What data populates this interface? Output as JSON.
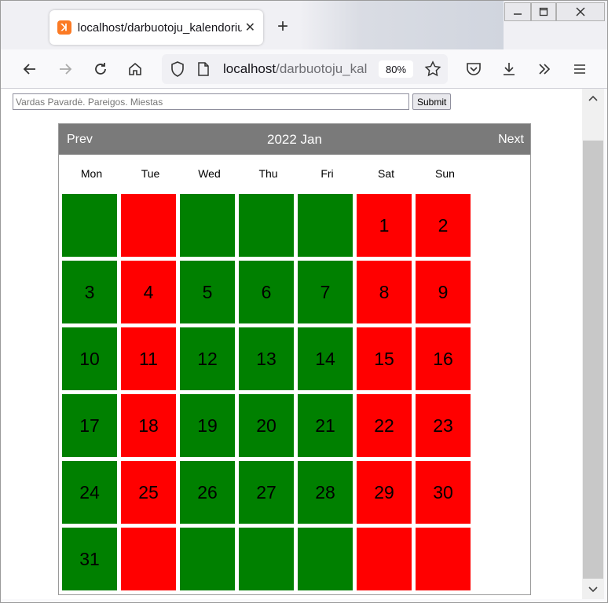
{
  "browser": {
    "tab_title": "localhost/darbuotoju_kalendorius",
    "url_host": "localhost",
    "url_path": "/darbuotoju_kal",
    "zoom": "80%",
    "new_tab": "+",
    "close_tab": "✕"
  },
  "search": {
    "placeholder": "Vardas Pavardė. Pareigos. Miestas",
    "submit_label": "Submit"
  },
  "calendar": {
    "prev_label": "Prev",
    "next_label": "Next",
    "title": "2022 Jan",
    "weekdays": [
      "Mon",
      "Tue",
      "Wed",
      "Thu",
      "Fri",
      "Sat",
      "Sun"
    ],
    "colors": {
      "green": "#008000",
      "red": "#ff0000",
      "header": "#7a7a7a"
    },
    "cells": [
      {
        "day": "",
        "color": "green"
      },
      {
        "day": "",
        "color": "red"
      },
      {
        "day": "",
        "color": "green"
      },
      {
        "day": "",
        "color": "green"
      },
      {
        "day": "",
        "color": "green"
      },
      {
        "day": "1",
        "color": "red"
      },
      {
        "day": "2",
        "color": "red"
      },
      {
        "day": "3",
        "color": "green"
      },
      {
        "day": "4",
        "color": "red"
      },
      {
        "day": "5",
        "color": "green"
      },
      {
        "day": "6",
        "color": "green"
      },
      {
        "day": "7",
        "color": "green"
      },
      {
        "day": "8",
        "color": "red"
      },
      {
        "day": "9",
        "color": "red"
      },
      {
        "day": "10",
        "color": "green"
      },
      {
        "day": "11",
        "color": "red"
      },
      {
        "day": "12",
        "color": "green"
      },
      {
        "day": "13",
        "color": "green"
      },
      {
        "day": "14",
        "color": "green"
      },
      {
        "day": "15",
        "color": "red"
      },
      {
        "day": "16",
        "color": "red"
      },
      {
        "day": "17",
        "color": "green"
      },
      {
        "day": "18",
        "color": "red"
      },
      {
        "day": "19",
        "color": "green"
      },
      {
        "day": "20",
        "color": "green"
      },
      {
        "day": "21",
        "color": "green"
      },
      {
        "day": "22",
        "color": "red"
      },
      {
        "day": "23",
        "color": "red"
      },
      {
        "day": "24",
        "color": "green"
      },
      {
        "day": "25",
        "color": "red"
      },
      {
        "day": "26",
        "color": "green"
      },
      {
        "day": "27",
        "color": "green"
      },
      {
        "day": "28",
        "color": "green"
      },
      {
        "day": "29",
        "color": "red"
      },
      {
        "day": "30",
        "color": "red"
      },
      {
        "day": "31",
        "color": "green"
      },
      {
        "day": "",
        "color": "red"
      },
      {
        "day": "",
        "color": "green"
      },
      {
        "day": "",
        "color": "green"
      },
      {
        "day": "",
        "color": "green"
      },
      {
        "day": "",
        "color": "red"
      },
      {
        "day": "",
        "color": "red"
      }
    ]
  }
}
